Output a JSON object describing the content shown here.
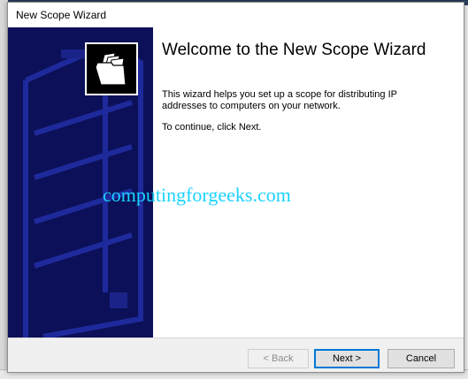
{
  "window": {
    "title": "New Scope Wizard"
  },
  "banner": {
    "icon": "folder-icon",
    "background_color": "#0c1058"
  },
  "content": {
    "heading": "Welcome to the New Scope Wizard",
    "description": "This wizard helps you set up a scope for distributing IP addresses to computers on your network.",
    "continue_text": "To continue, click Next."
  },
  "watermark": "computingforgeeks.com",
  "buttons": {
    "back": "< Back",
    "next": "Next >",
    "cancel": "Cancel"
  },
  "colors": {
    "focus_border": "#0078d7",
    "watermark": "#1ad3ff"
  }
}
